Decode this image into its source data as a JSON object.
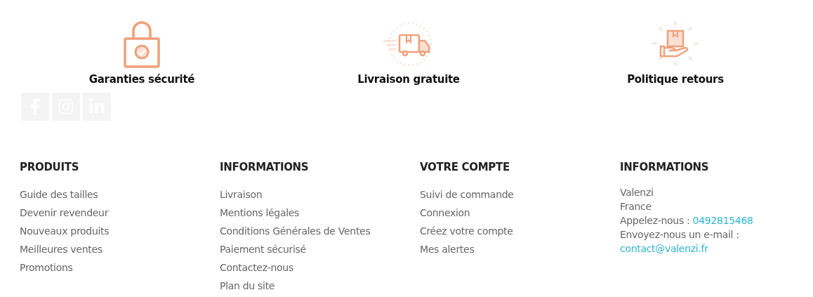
{
  "features": [
    {
      "kind": "lock",
      "title": "Garanties sécurité"
    },
    {
      "kind": "truck",
      "title": "Livraison gratuite"
    },
    {
      "kind": "returns",
      "title": "Politique retours"
    }
  ],
  "social": [
    {
      "kind": "facebook"
    },
    {
      "kind": "instagram"
    },
    {
      "kind": "linkedin"
    }
  ],
  "columns": [
    {
      "heading": "PRODUITS",
      "links": [
        "Guide des tailles",
        "Devenir revendeur",
        "Nouveaux produits",
        "Meilleures ventes",
        "Promotions"
      ]
    },
    {
      "heading": "INFORMATIONS",
      "links": [
        "Livraison",
        "Mentions légales",
        "Conditions Générales de Ventes",
        "Paiement sécurisé",
        "Contactez-nous",
        "Plan du site"
      ]
    },
    {
      "heading": "VOTRE COMPTE",
      "links": [
        "Suivi de commande",
        "Connexion",
        "Créez votre compte",
        "Mes alertes"
      ]
    }
  ],
  "contact": {
    "heading": "INFORMATIONS",
    "lines": [
      "Valenzi",
      "France"
    ],
    "phone": {
      "label": "Appelez-nous :",
      "value": "0492815468"
    },
    "email": {
      "label": "Envoyez-nous un e-mail :",
      "value": "contact@valenzi.fr"
    }
  }
}
